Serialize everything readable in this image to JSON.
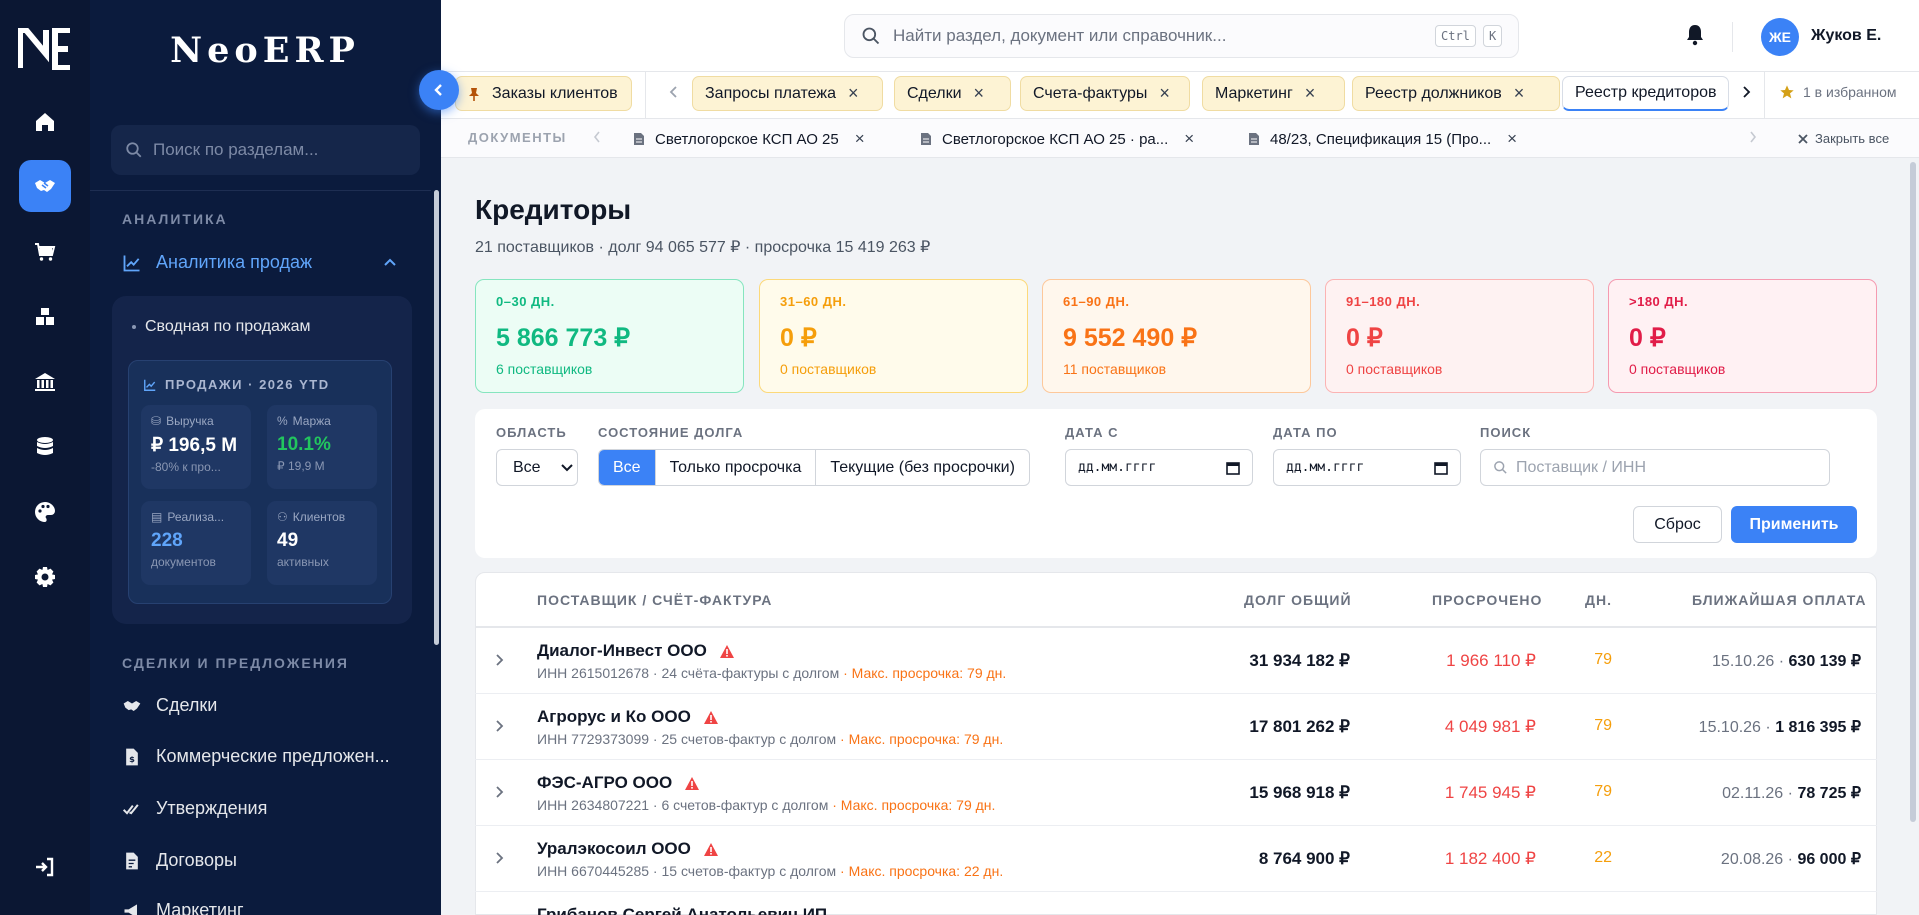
{
  "brand": {
    "name": "NeoERP"
  },
  "sidebar": {
    "search_placeholder": "Поиск по разделам...",
    "section_analytics": "АНАЛИТИКА",
    "analytics_item": "Аналитика продаж",
    "sub_item": "Сводная по продажам",
    "ytd": {
      "title": "ПРОДАЖИ · 2026 YTD",
      "kpis": [
        {
          "label": "Выручка",
          "value": "₽ 196,5 M",
          "sub": "-80% к про..."
        },
        {
          "label": "Маржа",
          "value": "10.1%",
          "sub": "₽ 19,9 M",
          "color": "#22c55e"
        },
        {
          "label": "Реализа...",
          "value": "228",
          "sub": "документов",
          "color": "#60a5fa"
        },
        {
          "label": "Клиентов",
          "value": "49",
          "sub": "активных"
        }
      ]
    },
    "section_deals": "СДЕЛКИ И ПРЕДЛОЖЕНИЯ",
    "items": [
      "Сделки",
      "Коммерческие предложен...",
      "Утверждения",
      "Договоры",
      "Маркетинг"
    ]
  },
  "header": {
    "search_placeholder": "Найти раздел, документ или справочник...",
    "kbd_ctrl": "Ctrl",
    "kbd_k": "K",
    "user_initials": "ЖЕ",
    "user_name": "Жуков Е."
  },
  "tabs": {
    "pinned": "Заказы клиентов",
    "items": [
      "Запросы платежа",
      "Сделки",
      "Счета-фактуры",
      "Маркетинг",
      "Реестр должников",
      "Реестр кредиторов"
    ],
    "favorites": "1 в избранном",
    "close_glyph": "×"
  },
  "docs": {
    "label": "ДОКУМЕНТЫ",
    "items": [
      "Светлогорское КСП АО 25",
      "Светлогорское КСП АО 25 · ра...",
      "48/23, Спецификация 15 (Про..."
    ],
    "close_all": "Закрыть все"
  },
  "page": {
    "title": "Кредиторы",
    "subtitle": "21 поставщиков · долг 94 065 577 ₽ · просрочка 15 419 263 ₽"
  },
  "aging": [
    {
      "label": "0–30 ДН.",
      "value": "5 866 773 ₽",
      "sub": "6 поставщиков",
      "color": "#10b981",
      "bg": "#ecfdf5",
      "border": "#86e5bf"
    },
    {
      "label": "31–60 ДН.",
      "value": "0 ₽",
      "sub": "0 поставщиков",
      "color": "#f59e0b",
      "bg": "#fffbeb",
      "border": "#fcd97a"
    },
    {
      "label": "61–90 ДН.",
      "value": "9 552 490 ₽",
      "sub": "11 поставщиков",
      "color": "#f97316",
      "bg": "#fff7ed",
      "border": "#fdc89b"
    },
    {
      "label": "91–180 ДН.",
      "value": "0 ₽",
      "sub": "0 поставщиков",
      "color": "#ef4444",
      "bg": "#fef2f2",
      "border": "#fbb3b3"
    },
    {
      "label": ">180 ДН.",
      "value": "0 ₽",
      "sub": "0 поставщиков",
      "color": "#e11d48",
      "bg": "#fff1f3",
      "border": "#f59ab0"
    }
  ],
  "filters": {
    "area_label": "ОБЛАСТЬ",
    "area_value": "Все",
    "state_label": "СОСТОЯНИЕ ДОЛГА",
    "state_options": [
      "Все",
      "Только просрочка",
      "Текущие (без просрочки)"
    ],
    "date_from_label": "ДАТА С",
    "date_to_label": "ДАТА ПО",
    "date_placeholder": "дд.мм.гггг",
    "search_label": "ПОИСК",
    "search_placeholder": "Поставщик / ИНН",
    "reset": "Сброс",
    "apply": "Применить"
  },
  "table": {
    "headers": {
      "vendor": "ПОСТАВЩИК / СЧЁТ-ФАКТУРА",
      "debt": "ДОЛГ ОБЩИЙ",
      "overdue": "ПРОСРОЧЕНО",
      "days": "ДН.",
      "next_pay": "БЛИЖАЙШАЯ ОПЛАТА"
    },
    "rows": [
      {
        "name": "Диалог-Инвест ООО",
        "info": "ИНН 2615012678 · 24 счёта-фактуры с долгом",
        "warn": "· Макс. просрочка: 79 дн.",
        "debt": "31 934 182 ₽",
        "overdue": "1 966 110 ₽",
        "days": "79",
        "pay_date": "15.10.26 ·",
        "pay_amount": "630 139 ₽"
      },
      {
        "name": "Агрорус и Ко ООО",
        "info": "ИНН 7729373099 · 25 счетов-фактур с долгом",
        "warn": "· Макс. просрочка: 79 дн.",
        "debt": "17 801 262 ₽",
        "overdue": "4 049 981 ₽",
        "days": "79",
        "pay_date": "15.10.26 ·",
        "pay_amount": "1 816 395 ₽"
      },
      {
        "name": "ФЭС-АГРО ООО",
        "info": "ИНН 2634807221 · 6 счетов-фактур с долгом",
        "warn": "· Макс. просрочка: 79 дн.",
        "debt": "15 968 918 ₽",
        "overdue": "1 745 945 ₽",
        "days": "79",
        "pay_date": "02.11.26 ·",
        "pay_amount": "78 725 ₽"
      },
      {
        "name": "Уралэкосоил ООО",
        "info": "ИНН 6670445285 · 15 счетов-фактур с долгом",
        "warn": "· Макс. просрочка: 22 дн.",
        "debt": "8 764 900 ₽",
        "overdue": "1 182 400 ₽",
        "days": "22",
        "pay_date": "20.08.26 ·",
        "pay_amount": "96 000 ₽"
      }
    ],
    "partial_row_name": "Грибанов Сергей Анатольевич ИП"
  }
}
